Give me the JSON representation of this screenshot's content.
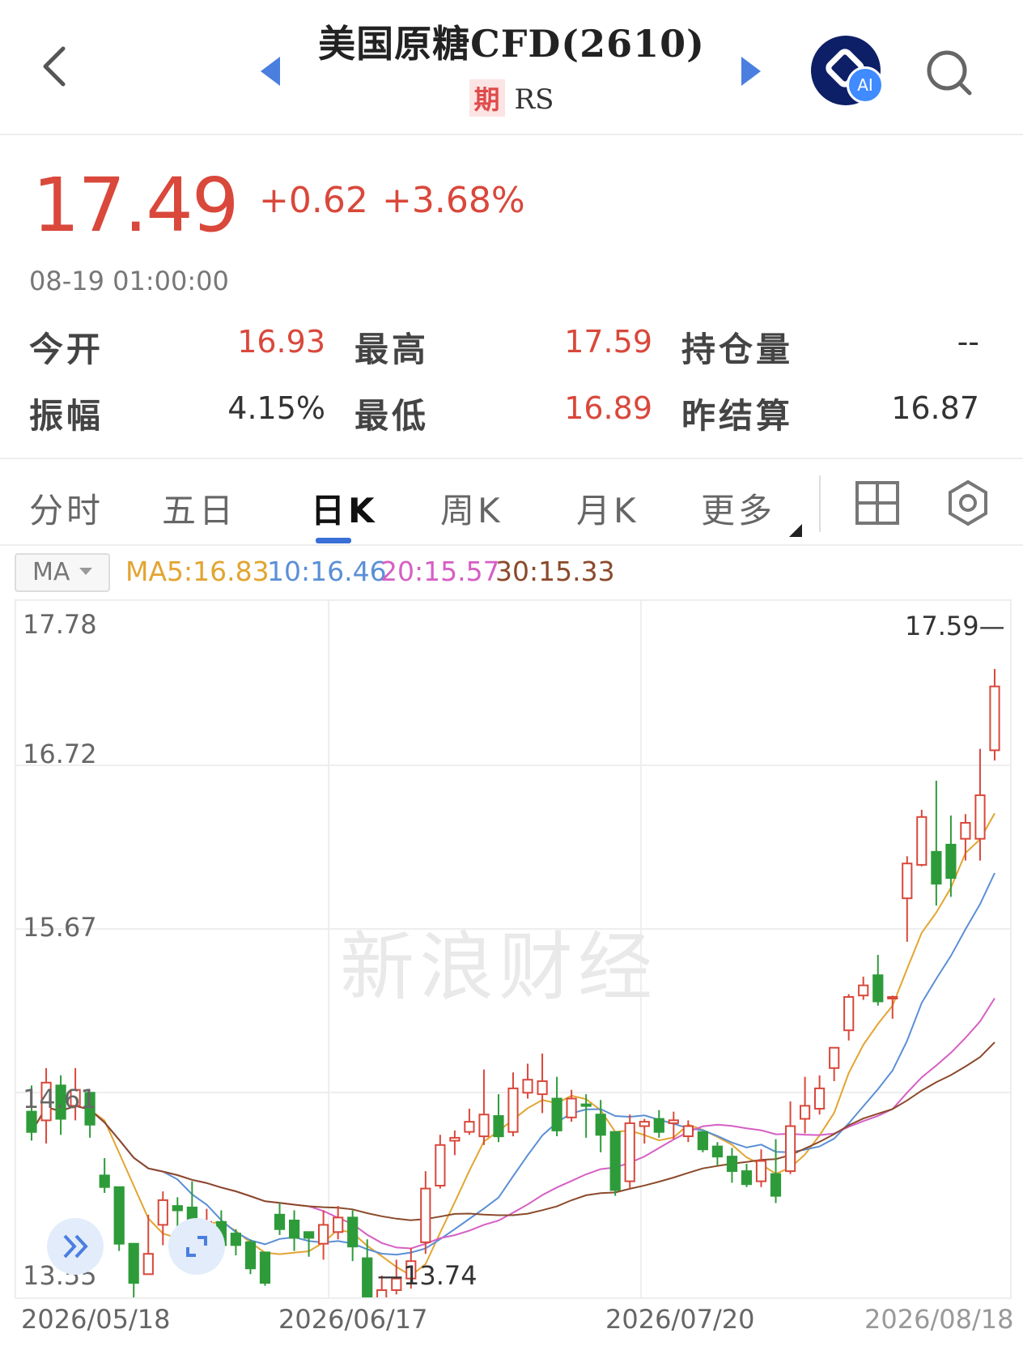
{
  "header": {
    "title": "美国原糖CFD(2610)",
    "tag": "期",
    "exchange": "RS",
    "ai_label": "AI"
  },
  "quote": {
    "price": "17.49",
    "change": "+0.62",
    "change_pct": "+3.68%",
    "time": "08-19 01:00:00",
    "stats": [
      {
        "label": "今开",
        "value": "16.93"
      },
      {
        "label": "最高",
        "value": "17.59"
      },
      {
        "label": "持仓量",
        "value": "--"
      },
      {
        "label": "振幅",
        "value": "4.15%"
      },
      {
        "label": "最低",
        "value": "16.89"
      },
      {
        "label": "昨结算",
        "value": "16.87"
      }
    ]
  },
  "tabs": [
    "分时",
    "五日",
    "日K",
    "周K",
    "月K",
    "更多"
  ],
  "active_tab": "日K",
  "indicator": {
    "selector": "MA",
    "ma5": "MA5:16.83",
    "ma10": "10:16.46",
    "ma20": "20:15.57",
    "ma30": "30:15.33"
  },
  "colors": {
    "up": "#d9483b",
    "down": "#2e9b3a",
    "ma5": "#e2a531",
    "ma10": "#5b8fd6",
    "ma20": "#d65fc4",
    "ma30": "#8b4a2b"
  },
  "watermark": "新浪财经",
  "chart_data": {
    "type": "candlestick",
    "y_ticks": [
      "17.78",
      "16.72",
      "15.67",
      "14.61",
      "13.55"
    ],
    "ylim": [
      13.55,
      17.78
    ],
    "x_ticks": [
      "2026/05/18",
      "2026/06/17",
      "2026/07/20",
      "2026/08/18"
    ],
    "high_label": "17.59",
    "low_label": "13.74",
    "candles": [
      [
        14.54,
        14.4,
        14.72,
        14.34
      ],
      [
        14.48,
        14.74,
        14.84,
        14.32
      ],
      [
        14.72,
        14.49,
        14.79,
        14.38
      ],
      [
        14.58,
        14.69,
        14.84,
        14.48
      ],
      [
        14.67,
        14.45,
        14.67,
        14.36
      ],
      [
        14.1,
        14.02,
        14.22,
        13.98
      ],
      [
        14.02,
        13.63,
        14.02,
        13.58
      ],
      [
        13.63,
        13.36,
        13.63,
        13.26
      ],
      [
        13.42,
        13.56,
        13.83,
        13.42
      ],
      [
        13.76,
        13.93,
        13.99,
        13.62
      ],
      [
        13.89,
        13.86,
        13.95,
        13.73
      ],
      [
        13.88,
        13.71,
        14.06,
        13.69
      ],
      [
        13.72,
        13.78,
        13.87,
        13.65
      ],
      [
        13.78,
        13.62,
        13.86,
        13.56
      ],
      [
        13.7,
        13.62,
        13.73,
        13.55
      ],
      [
        13.64,
        13.46,
        13.66,
        13.42
      ],
      [
        13.57,
        13.36,
        13.57,
        13.34
      ],
      [
        13.83,
        13.73,
        13.91,
        13.69
      ],
      [
        13.79,
        13.67,
        13.86,
        13.58
      ],
      [
        13.71,
        13.67,
        13.71,
        13.54
      ],
      [
        13.63,
        13.76,
        13.86,
        13.52
      ],
      [
        13.71,
        13.81,
        13.89,
        13.66
      ],
      [
        13.81,
        13.61,
        13.86,
        13.51
      ],
      [
        13.53,
        13.23,
        13.66,
        13.17
      ],
      [
        13.23,
        13.31,
        13.41,
        13.22
      ],
      [
        13.31,
        13.39,
        13.52,
        13.28
      ],
      [
        13.39,
        13.51,
        13.6,
        13.32
      ],
      [
        13.64,
        14.01,
        14.13,
        13.56
      ],
      [
        14.03,
        14.31,
        14.38,
        14.01
      ],
      [
        14.34,
        14.36,
        14.41,
        14.24
      ],
      [
        14.4,
        14.47,
        14.56,
        14.38
      ],
      [
        14.37,
        14.52,
        14.83,
        14.31
      ],
      [
        14.51,
        14.37,
        14.66,
        14.33
      ],
      [
        14.4,
        14.7,
        14.81,
        14.37
      ],
      [
        14.67,
        14.76,
        14.87,
        14.63
      ],
      [
        14.66,
        14.75,
        14.94,
        14.53
      ],
      [
        14.63,
        14.41,
        14.78,
        14.37
      ],
      [
        14.5,
        14.63,
        14.69,
        14.47
      ],
      [
        14.59,
        14.58,
        14.66,
        14.36
      ],
      [
        14.52,
        14.38,
        14.62,
        14.26
      ],
      [
        14.4,
        14.0,
        14.4,
        13.96
      ],
      [
        14.06,
        14.46,
        14.52,
        14.01
      ],
      [
        14.44,
        14.47,
        14.49,
        14.32
      ],
      [
        14.49,
        14.4,
        14.55,
        14.36
      ],
      [
        14.46,
        14.48,
        14.54,
        14.35
      ],
      [
        14.37,
        14.44,
        14.48,
        14.33
      ],
      [
        14.4,
        14.28,
        14.4,
        14.26
      ],
      [
        14.3,
        14.23,
        14.33,
        14.17
      ],
      [
        14.23,
        14.13,
        14.29,
        14.05
      ],
      [
        14.13,
        14.04,
        14.18,
        14.02
      ],
      [
        14.06,
        14.2,
        14.28,
        14.02
      ],
      [
        14.11,
        13.96,
        14.35,
        13.91
      ],
      [
        14.13,
        14.44,
        14.61,
        14.11
      ],
      [
        14.49,
        14.58,
        14.78,
        14.39
      ],
      [
        14.56,
        14.7,
        14.79,
        14.52
      ],
      [
        14.84,
        14.98,
        14.98,
        14.75
      ],
      [
        15.1,
        15.33,
        15.35,
        15.03
      ],
      [
        15.34,
        15.41,
        15.47,
        15.31
      ],
      [
        15.48,
        15.3,
        15.62,
        15.27
      ],
      [
        15.32,
        15.33,
        15.34,
        15.18
      ],
      [
        16.01,
        16.25,
        16.3,
        15.71
      ],
      [
        16.24,
        16.57,
        16.62,
        16.23
      ],
      [
        16.33,
        16.11,
        16.82,
        15.96
      ],
      [
        16.38,
        16.15,
        16.58,
        16.02
      ],
      [
        16.42,
        16.53,
        16.59,
        16.27
      ],
      [
        16.42,
        16.72,
        17.04,
        16.27
      ],
      [
        17.03,
        17.47,
        17.59,
        16.96
      ]
    ]
  }
}
